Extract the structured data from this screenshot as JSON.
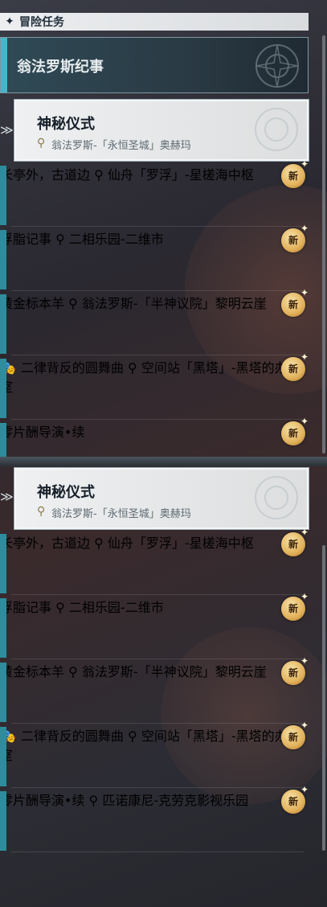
{
  "header": {
    "title": "冒险任务",
    "icon": "diamond-icon"
  },
  "category": {
    "label": "翁法罗斯纪事"
  },
  "selected_quest": {
    "name": "神秘仪式",
    "location": "翁法罗斯-「永恒圣城」奥赫玛"
  },
  "quests_panel1": [
    {
      "name": "长亭外，古道边",
      "location": "仙舟「罗浮」-星槎海中枢",
      "badge": "新",
      "gift": false
    },
    {
      "name": "浮脂记事",
      "location": "二相乐园-二维市",
      "badge": "新",
      "gift": false
    },
    {
      "name": "黄金标本羊",
      "location": "翁法罗斯-「半神议院」黎明云崖",
      "badge": "新",
      "gift": false
    },
    {
      "name": "二律背反的圆舞曲",
      "location": "空间站「黑塔」-黑塔的办公室",
      "badge": "新",
      "gift": true
    },
    {
      "name": "零片酬导演•续",
      "location": "",
      "badge": "新",
      "gift": false
    }
  ],
  "quests_panel2": [
    {
      "name": "长亭外，古道边",
      "location": "仙舟「罗浮」-星槎海中枢",
      "badge": "新",
      "gift": false
    },
    {
      "name": "浮脂记事",
      "location": "二相乐园-二维市",
      "badge": "新",
      "gift": false
    },
    {
      "name": "黄金标本羊",
      "location": "翁法罗斯-「半神议院」黎明云崖",
      "badge": "新",
      "gift": false
    },
    {
      "name": "二律背反的圆舞曲",
      "location": "空间站「黑塔」-黑塔的办公室",
      "badge": "新",
      "gift": true
    },
    {
      "name": "零片酬导演•续",
      "location": "匹诺康尼-克劳克影视乐园",
      "badge": "新",
      "gift": false
    }
  ],
  "colors": {
    "accent": "#46b4c9",
    "badge": "#e2b15a",
    "quest_bar": "#2f8c9c"
  }
}
